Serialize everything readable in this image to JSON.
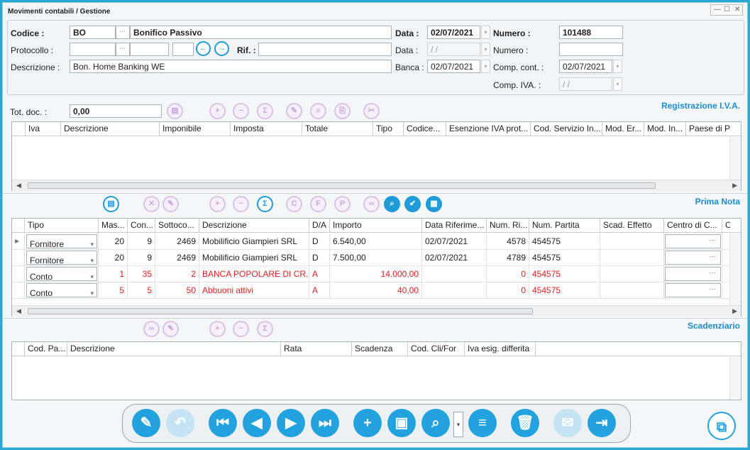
{
  "window": {
    "title": "Movimenti contabili / Gestione",
    "min": "—",
    "max": "☐",
    "close": "✕"
  },
  "header": {
    "codice_label": "Codice :",
    "codice_value": "BO",
    "codice_desc": "Bonifico Passivo",
    "data_label": "Data :",
    "data_value": "02/07/2021",
    "numero_label": "Numero :",
    "numero_value": "101488",
    "protocollo_label": "Protocollo :",
    "rif_label": "Rif. :",
    "data2_label": "Data :",
    "data2_value": " /  /",
    "numero2_label": "Numero :",
    "descrizione_label": "Descrizione :",
    "descrizione_value": "Bon. Home Banking WE",
    "banca_label": "Banca :",
    "banca_value": "02/07/2021",
    "compcont_label": "Comp. cont. :",
    "compcont_value": "02/07/2021",
    "compiva_label": "Comp. IVA. :",
    "compiva_value": " /  /"
  },
  "iva": {
    "section_title": "Registrazione I.V.A.",
    "totdoc_label": "Tot. doc. :",
    "totdoc_value": "0,00",
    "columns": [
      "Iva",
      "Descrizione",
      "Imponibile",
      "Imposta",
      "Totale",
      "Tipo",
      "Codice...",
      "Esenzione IVA prot...",
      "Cod. Servizio In...",
      "Mod. Er...",
      "Mod. In...",
      "Paese di Pa"
    ]
  },
  "prima_nota": {
    "section_title": "Prima Nota",
    "columns": [
      "Tipo",
      "Mas...",
      "Con...",
      "Sottoco...",
      "Descrizione",
      "D/A",
      "Importo",
      "Data Riferime...",
      "Num. Ri...",
      "Num. Partita",
      "Scad. Effetto",
      "Centro di C...",
      "C"
    ],
    "rows": [
      {
        "tipo": "Fornitore",
        "mas": "20",
        "con": "9",
        "sotto": "2469",
        "desc": "Mobilificio Giampieri SRL",
        "da": "D",
        "importo_l": "6.540,00",
        "importo_r": "",
        "data": "02/07/2021",
        "numri": "4578",
        "partita": "454575",
        "red": false
      },
      {
        "tipo": "Fornitore",
        "mas": "20",
        "con": "9",
        "sotto": "2469",
        "desc": "Mobilificio Giampieri SRL",
        "da": "D",
        "importo_l": "7.500,00",
        "importo_r": "",
        "data": "02/07/2021",
        "numri": "4789",
        "partita": "454575",
        "red": false
      },
      {
        "tipo": "Conto",
        "mas": "1",
        "con": "35",
        "sotto": "2",
        "desc": "BANCA POPOLARE DI CR...",
        "da": "A",
        "importo_l": "",
        "importo_r": "14.000,00",
        "data": "",
        "numri": "0",
        "partita": "454575",
        "red": true
      },
      {
        "tipo": "Conto",
        "mas": "5",
        "con": "5",
        "sotto": "50",
        "desc": "Abbuoni attivi",
        "da": "A",
        "importo_l": "",
        "importo_r": "40,00",
        "data": "",
        "numri": "0",
        "partita": "454575",
        "red": true
      }
    ]
  },
  "scadenziario": {
    "section_title": "Scadenziario",
    "columns": [
      "Cod. Pa...",
      "Descrizione",
      "Rata",
      "Scadenza",
      "Cod. Cli/For",
      "Iva esig. differita"
    ]
  },
  "colors": {
    "accent": "#23a2e0",
    "section": "#1a8fd0",
    "red": "#e02020"
  }
}
